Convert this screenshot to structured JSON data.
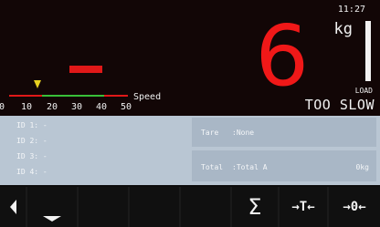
{
  "header": {
    "time": "11:27"
  },
  "weight": {
    "value": "6",
    "unit": "kg"
  },
  "load": {
    "label": "LOAD",
    "status": "TOO SLOW"
  },
  "speed": {
    "label": "Speed",
    "ticks": [
      "0",
      "10",
      "20",
      "30",
      "40",
      "50"
    ],
    "indicator_value": 15,
    "green_range": [
      10,
      40
    ]
  },
  "ids": [
    {
      "label": "ID 1: -"
    },
    {
      "label": "ID 2: -"
    },
    {
      "label": "ID 3: -"
    },
    {
      "label": "ID 4: -"
    }
  ],
  "tare": {
    "label": "Tare",
    "value": ":None"
  },
  "total": {
    "label": "Total",
    "value": ":Total A",
    "amount": "0kg"
  },
  "softkeys": {
    "sum": "Σ",
    "tare": "→T←",
    "zero": "→0←"
  },
  "colors": {
    "weight": "#f01818",
    "indicator": "#e8d020",
    "green": "#38c038",
    "red": "#e01818",
    "panel": "#b9c6d3"
  }
}
